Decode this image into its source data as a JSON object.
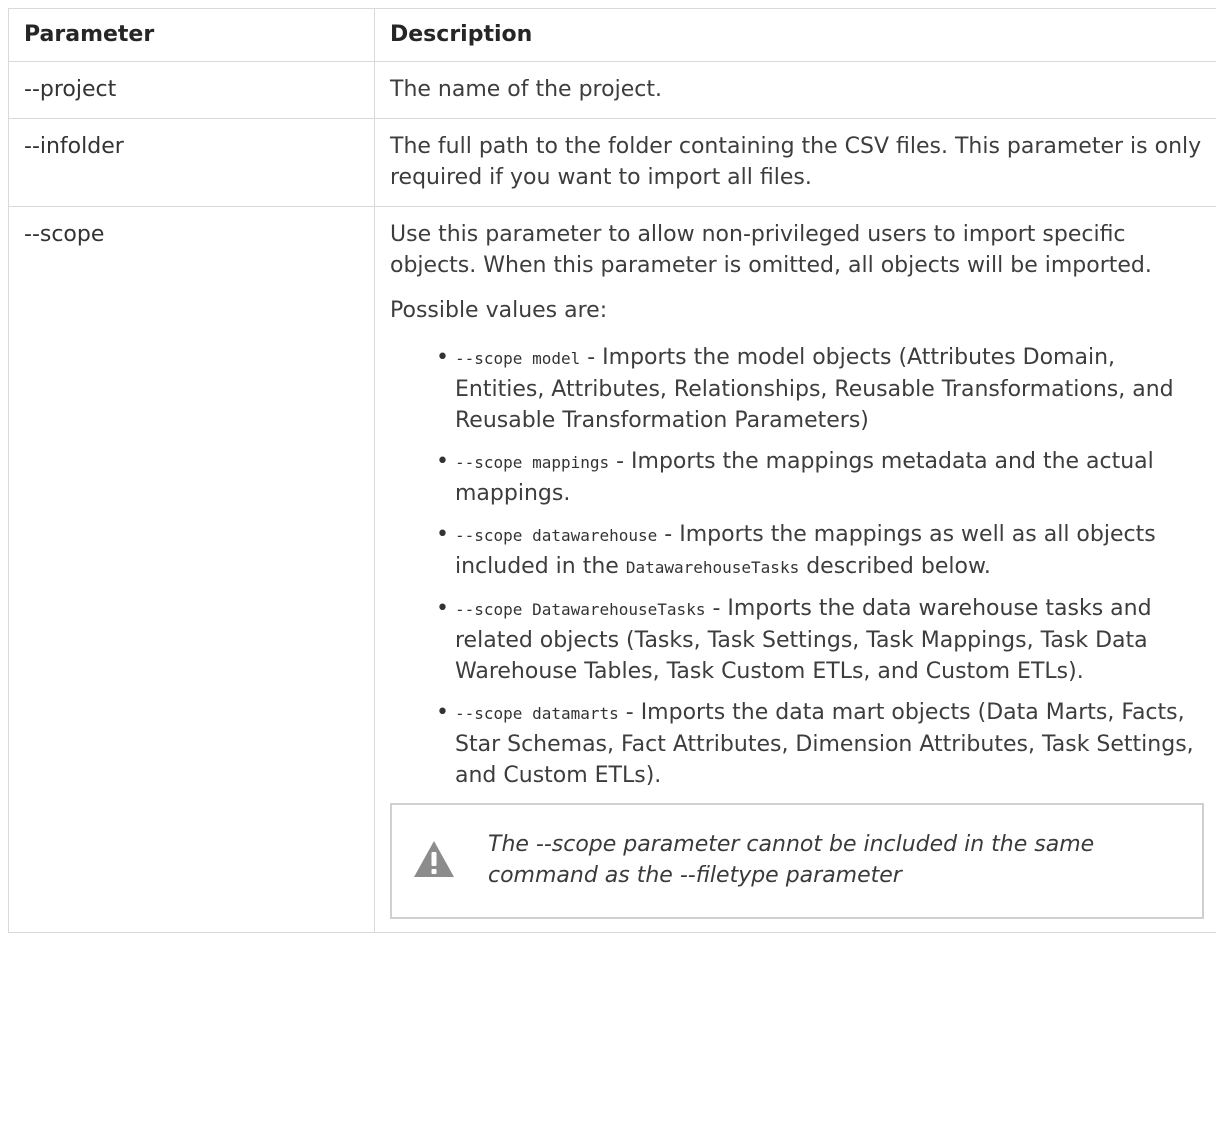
{
  "table": {
    "headers": {
      "parameter": "Parameter",
      "description": "Description"
    },
    "rows": [
      {
        "parameter": "--project",
        "description": "The name of the project."
      },
      {
        "parameter": "--infolder",
        "description": "The full path to the folder containing the CSV files. This parameter is only required if you want to import all files."
      },
      {
        "parameter": "--scope",
        "intro": "Use this parameter to allow non-privileged users to import specific objects. When this parameter is omitted, all objects will be imported.",
        "possible_values_label": "Possible values are:",
        "bullets": [
          {
            "code": "--scope model",
            "text": " - Imports the model objects (Attributes Domain, Entities, Attributes, Relationships, Reusable Transformations, and Reusable Transformation Parameters)"
          },
          {
            "code": "--scope mappings",
            "text": " - Imports the mappings metadata and the actual mappings."
          },
          {
            "code": "--scope datawarehouse",
            "text_before": " - Imports the mappings as well as all objects included in the ",
            "inline_code": "DatawarehouseTasks",
            "text_after": " described below."
          },
          {
            "code": "--scope DatawarehouseTasks",
            "text": " - Imports the data warehouse tasks and related objects (Tasks, Task Settings, Task Mappings, Task Data Warehouse Tables, Task Custom ETLs, and Custom ETLs)."
          },
          {
            "code": "--scope datamarts",
            "text": " - Imports the data mart objects (Data Marts, Facts, Star Schemas, Fact Attributes, Dimension Attributes, Task Settings, and Custom ETLs)."
          }
        ],
        "note": {
          "icon": "warning-icon",
          "icon_color": "#8c8c8c",
          "text": "The --scope parameter cannot be included in the same command as the --filetype parameter"
        }
      }
    ]
  }
}
